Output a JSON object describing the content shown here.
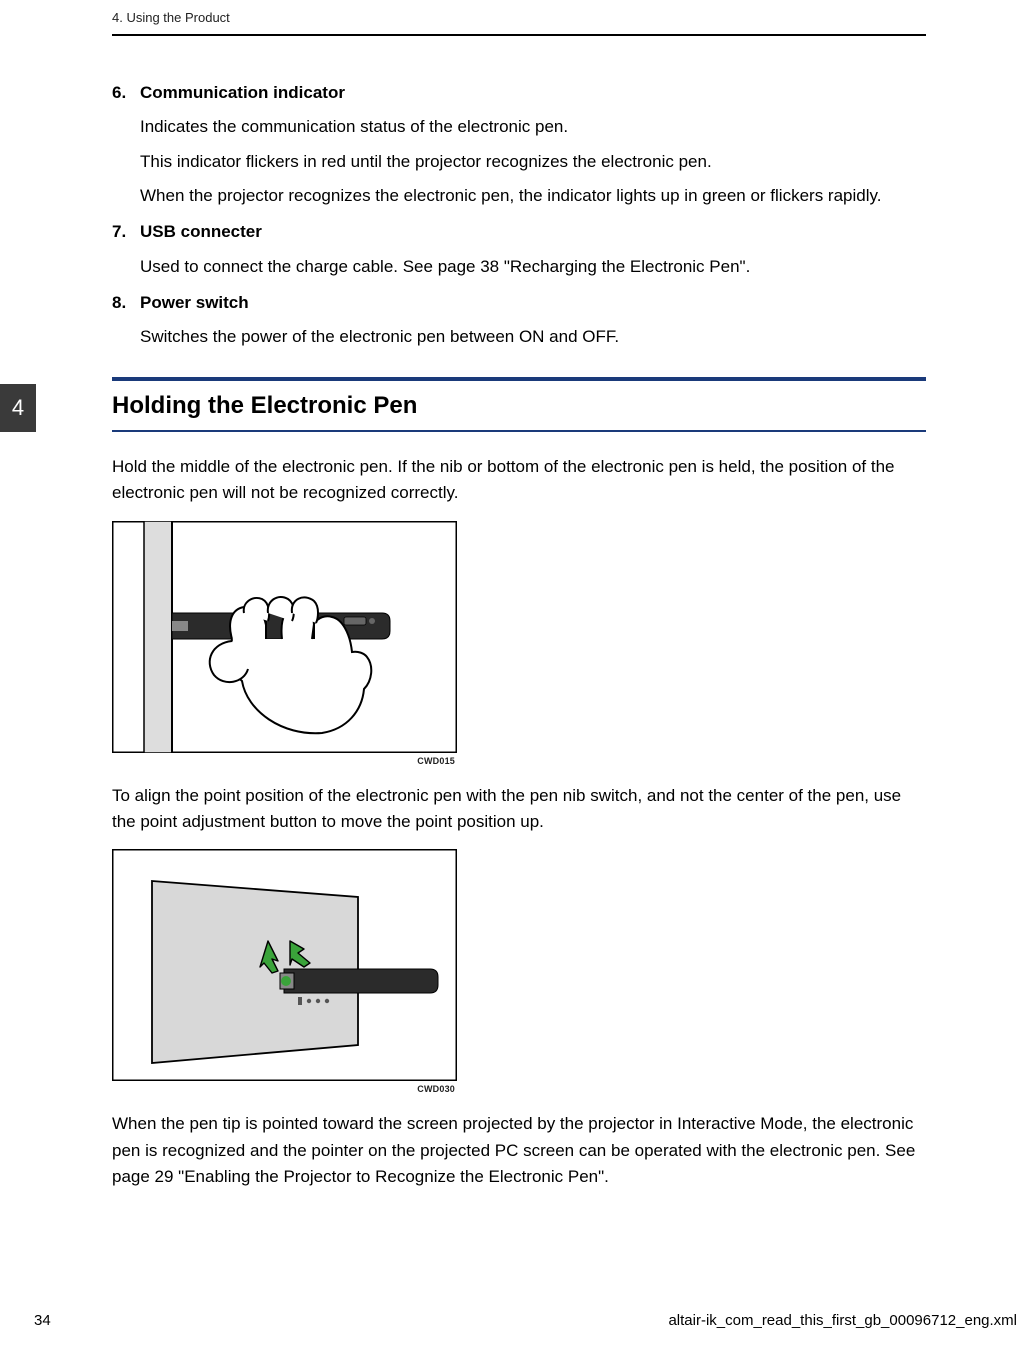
{
  "header": {
    "chapter": "4. Using the Product"
  },
  "tab": {
    "number": "4"
  },
  "items": [
    {
      "num": "6.",
      "title": "Communication indicator",
      "paras": [
        "Indicates the communication status of the electronic pen.",
        "This indicator flickers in red until the projector recognizes the electronic pen.",
        "When the projector recognizes the electronic pen, the indicator lights up in green or flickers rapidly."
      ]
    },
    {
      "num": "7.",
      "title": "USB connecter",
      "paras": [
        "Used to connect the charge cable. See page 38 \"Recharging the Electronic Pen\"."
      ]
    },
    {
      "num": "8.",
      "title": "Power switch",
      "paras": [
        "Switches the power of the electronic pen between ON and OFF."
      ]
    }
  ],
  "section": {
    "title": "Holding the Electronic Pen",
    "para1": "Hold the middle of the electronic pen. If the nib or bottom of the electronic pen is held, the position of the electronic pen will not be recognized correctly.",
    "fig1_caption": "CWD015",
    "para2": "To align the point position of the electronic pen with the pen nib switch, and not the center of the pen, use the point adjustment button to move the point position up.",
    "fig2_caption": "CWD030",
    "para3": "When the pen tip is pointed toward the screen projected by the projector in Interactive Mode, the electronic pen is recognized and the pointer on the projected PC screen can be operated with the electronic pen. See page 29 \"Enabling the Projector to Recognize the Electronic Pen\"."
  },
  "footer": {
    "page": "34",
    "file": "altair-ik_com_read_this_first_gb_00096712_eng.xml"
  }
}
